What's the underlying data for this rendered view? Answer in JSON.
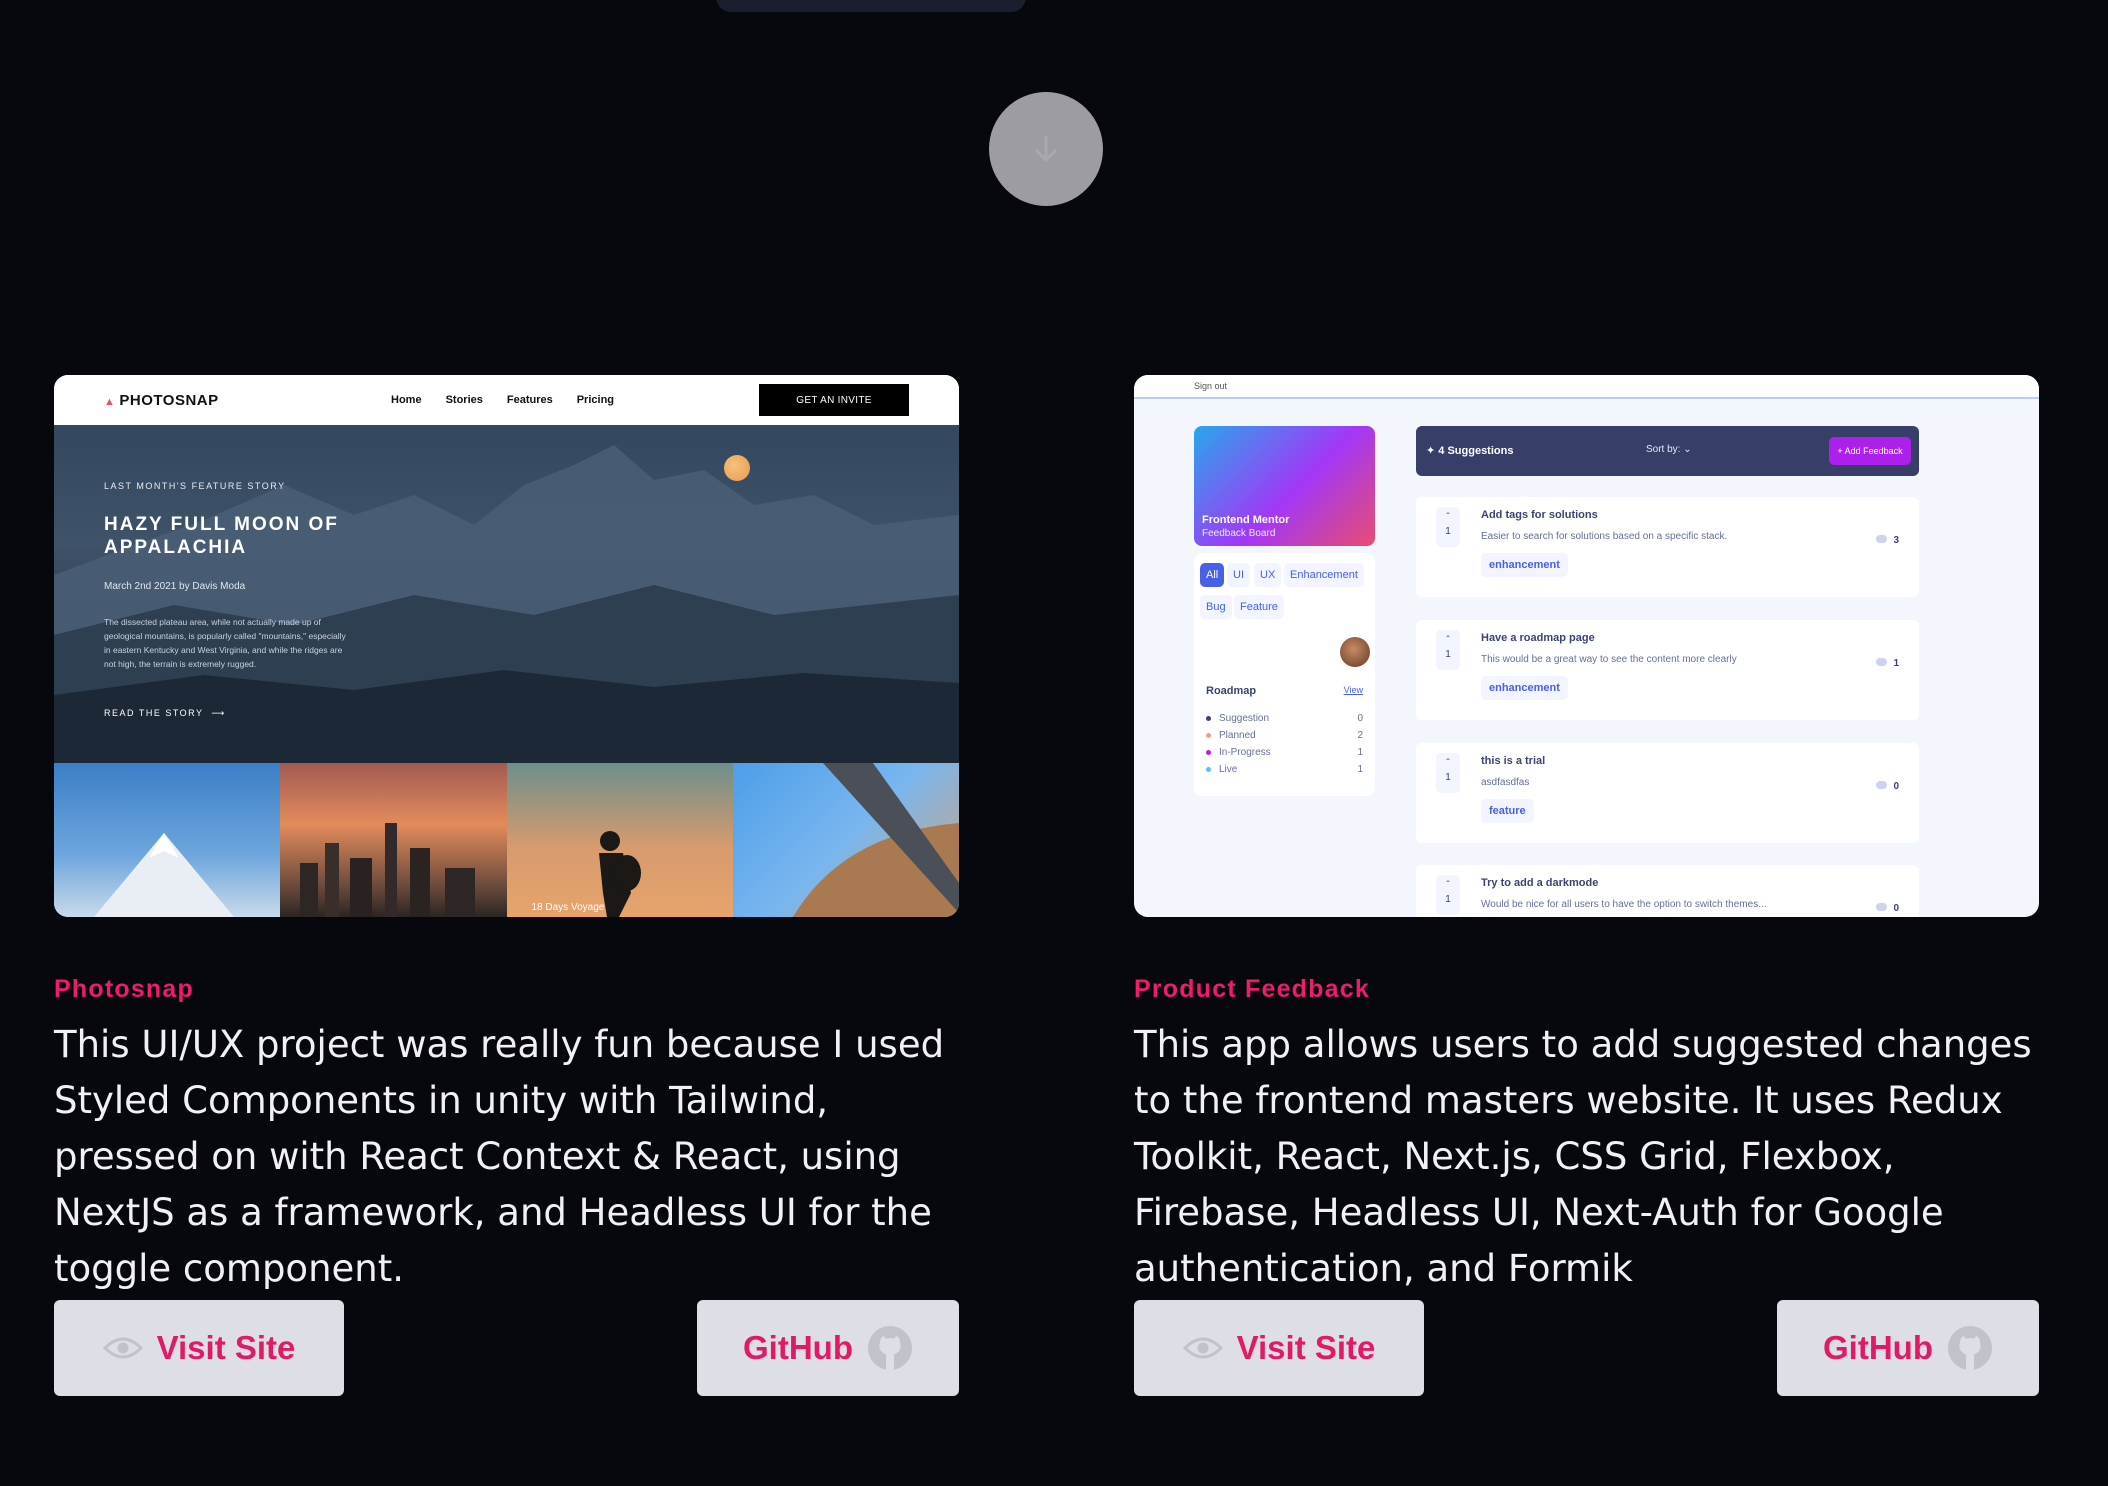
{
  "top": {
    "scroll_down_icon": "arrow-down-icon"
  },
  "projects": [
    {
      "title": "Photosnap",
      "description": "This UI/UX project was really fun because I used Styled Components in unity with Tailwind, pressed on with React Context & React, using NextJS as a framework, and Headless UI for the toggle component.",
      "visit_label": "Visit Site",
      "github_label": "GitHub",
      "screenshot": {
        "logo": "PHOTOSNAP",
        "nav": [
          "Home",
          "Stories",
          "Features",
          "Pricing"
        ],
        "cta": "GET AN INVITE",
        "eyebrow": "LAST MONTH'S FEATURE STORY",
        "headline": "HAZY FULL MOON OF APPALACHIA",
        "date": "March 2nd 2021 by Davis Moda",
        "body": "The dissected plateau area, while not actually made up of geological mountains, is popularly called \"mountains,\" especially in eastern Kentucky and West Virginia, and while the ridges are not high, the terrain is extremely rugged.",
        "read": "READ THE STORY",
        "tile_caption": "18 Days Voyage"
      }
    },
    {
      "title": "Product Feedback",
      "description": "This app allows users to add suggested changes to the frontend masters website. It uses Redux Toolkit, React, Next.js, CSS Grid, Flexbox, Firebase, Headless UI, Next-Auth for Google authentication, and Formik",
      "visit_label": "Visit Site",
      "github_label": "GitHub",
      "screenshot": {
        "sign_out": "Sign out",
        "board_title": "Frontend Mentor",
        "board_sub": "Feedback Board",
        "tags": [
          "All",
          "UI",
          "UX",
          "Enhancement",
          "Bug",
          "Feature"
        ],
        "roadmap_title": "Roadmap",
        "roadmap_view": "View",
        "roadmap": [
          {
            "label": "Suggestion",
            "count": "0",
            "color": "#3a4374"
          },
          {
            "label": "Planned",
            "count": "2",
            "color": "#f49f85"
          },
          {
            "label": "In-Progress",
            "count": "1",
            "color": "#ad1fea"
          },
          {
            "label": "Live",
            "count": "1",
            "color": "#62bcfa"
          }
        ],
        "suggestions_count": "4 Suggestions",
        "sort_label": "Sort by:",
        "add_feedback": "+ Add Feedback",
        "items": [
          {
            "title": "Add tags for solutions",
            "desc": "Easier to search for solutions based on a specific stack.",
            "tag": "enhancement",
            "votes": "1",
            "comments": "3"
          },
          {
            "title": "Have a roadmap page",
            "desc": "This would be a great way to see the content more clearly",
            "tag": "enhancement",
            "votes": "1",
            "comments": "1"
          },
          {
            "title": "this is a trial",
            "desc": "asdfasdfas",
            "tag": "feature",
            "votes": "1",
            "comments": "0"
          },
          {
            "title": "Try to add a darkmode",
            "desc": "Would be nice for all users to have the option to switch themes...",
            "tag": "",
            "votes": "1",
            "comments": "0"
          }
        ]
      }
    }
  ],
  "colors": {
    "accent": "#ec1d6a",
    "background": "#07080d",
    "button_bg": "#dedfe6"
  }
}
